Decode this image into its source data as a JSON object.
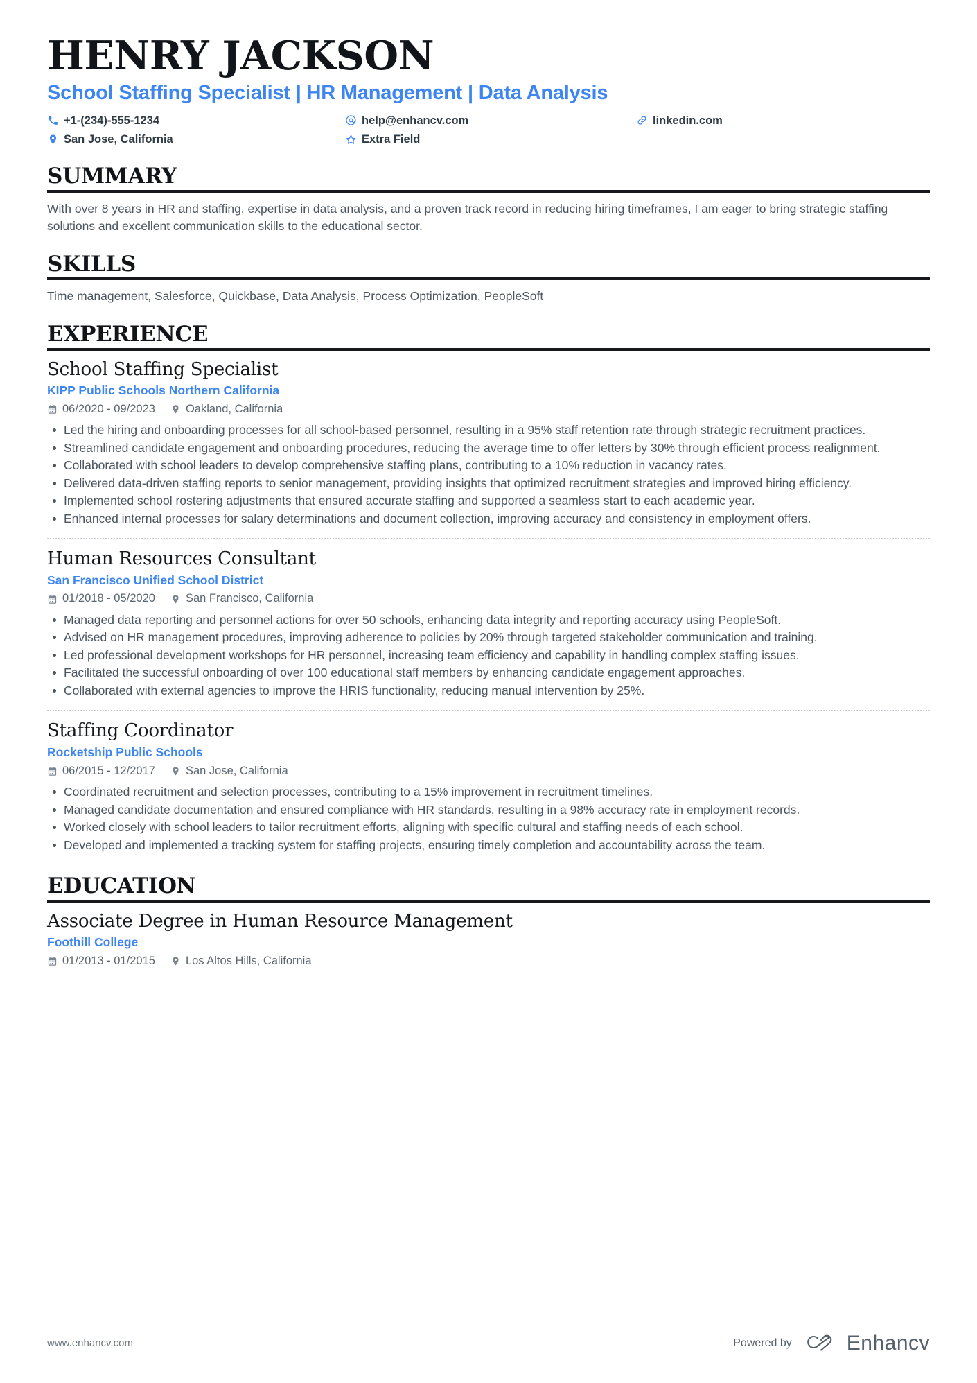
{
  "theme": {
    "accent": "#3d85f0",
    "text": "#4a555f",
    "heading": "#111418"
  },
  "header": {
    "name": "Henry Jackson",
    "headline": "School Staffing Specialist | HR Management | Data Analysis",
    "contacts": [
      {
        "icon": "phone-icon",
        "value": "+1-(234)-555-1234"
      },
      {
        "icon": "email-icon",
        "value": "help@enhancv.com"
      },
      {
        "icon": "link-icon",
        "value": "linkedin.com"
      },
      {
        "icon": "location-icon",
        "value": "San Jose, California"
      },
      {
        "icon": "star-icon",
        "value": "Extra Field"
      }
    ]
  },
  "sections": {
    "summary": {
      "title": "Summary",
      "text": "With over 8 years in HR and staffing, expertise in data analysis, and a proven track record in reducing hiring timeframes, I am eager to bring strategic staffing solutions and excellent communication skills to the educational sector."
    },
    "skills": {
      "title": "Skills",
      "text": "Time management, Salesforce, Quickbase, Data Analysis, Process Optimization, PeopleSoft"
    },
    "experience": {
      "title": "Experience",
      "entries": [
        {
          "title": "School Staffing Specialist",
          "org": "KIPP Public Schools Northern California",
          "dates": "06/2020 - 09/2023",
          "location": "Oakland, California",
          "bullets": [
            "Led the hiring and onboarding processes for all school-based personnel, resulting in a 95% staff retention rate through strategic recruitment practices.",
            "Streamlined candidate engagement and onboarding procedures, reducing the average time to offer letters by 30% through efficient process realignment.",
            "Collaborated with school leaders to develop comprehensive staffing plans, contributing to a 10% reduction in vacancy rates.",
            "Delivered data-driven staffing reports to senior management, providing insights that optimized recruitment strategies and improved hiring efficiency.",
            "Implemented school rostering adjustments that ensured accurate staffing and supported a seamless start to each academic year.",
            "Enhanced internal processes for salary determinations and document collection, improving accuracy and consistency in employment offers."
          ]
        },
        {
          "title": "Human Resources Consultant",
          "org": "San Francisco Unified School District",
          "dates": "01/2018 - 05/2020",
          "location": "San Francisco, California",
          "bullets": [
            "Managed data reporting and personnel actions for over 50 schools, enhancing data integrity and reporting accuracy using PeopleSoft.",
            "Advised on HR management procedures, improving adherence to policies by 20% through targeted stakeholder communication and training.",
            "Led professional development workshops for HR personnel, increasing team efficiency and capability in handling complex staffing issues.",
            "Facilitated the successful onboarding of over 100 educational staff members by enhancing candidate engagement approaches.",
            "Collaborated with external agencies to improve the HRIS functionality, reducing manual intervention by 25%."
          ]
        },
        {
          "title": "Staffing Coordinator",
          "org": "Rocketship Public Schools",
          "dates": "06/2015 - 12/2017",
          "location": "San Jose, California",
          "bullets": [
            "Coordinated recruitment and selection processes, contributing to a 15% improvement in recruitment timelines.",
            "Managed candidate documentation and ensured compliance with HR standards, resulting in a 98% accuracy rate in employment records.",
            "Worked closely with school leaders to tailor recruitment efforts, aligning with specific cultural and staffing needs of each school.",
            "Developed and implemented a tracking system for staffing projects, ensuring timely completion and accountability across the team."
          ]
        }
      ]
    },
    "education": {
      "title": "Education",
      "entries": [
        {
          "title": "Associate Degree in Human Resource Management",
          "org": "Foothill College",
          "dates": "01/2013 - 01/2015",
          "location": "Los Altos Hills, California"
        }
      ]
    }
  },
  "footer": {
    "url": "www.enhancv.com",
    "powered_by": "Powered by",
    "brand": "Enhancv"
  }
}
